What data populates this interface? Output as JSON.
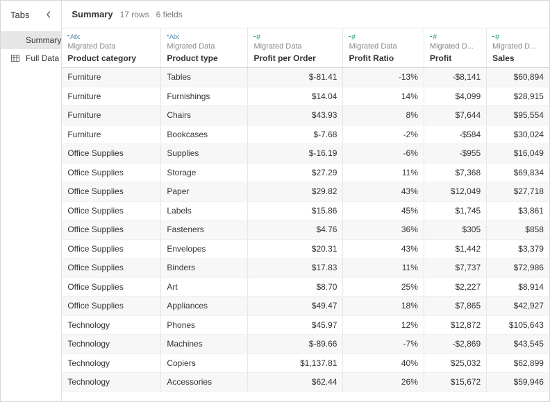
{
  "sidebar": {
    "title": "Tabs",
    "items": [
      {
        "label": "Summary",
        "icon": null,
        "active": true
      },
      {
        "label": "Full Data",
        "icon": "table",
        "active": false
      }
    ]
  },
  "header": {
    "title": "Summary",
    "rows_label": "17 rows",
    "fields_label": "6 fields"
  },
  "columns": [
    {
      "type": "text",
      "type_label": "Abc",
      "source": "Migrated Data",
      "name": "Product category",
      "align": "left"
    },
    {
      "type": "text",
      "type_label": "Abc",
      "source": "Migrated Data",
      "name": "Product type",
      "align": "left"
    },
    {
      "type": "number",
      "type_label": "#",
      "source": "Migrated Data",
      "name": "Profit per Order",
      "align": "right"
    },
    {
      "type": "number",
      "type_label": "#",
      "source": "Migrated Data",
      "name": "Profit Ratio",
      "align": "right"
    },
    {
      "type": "number",
      "type_label": "#",
      "source": "Migrated D...",
      "name": "Profit",
      "align": "right"
    },
    {
      "type": "number",
      "type_label": "#",
      "source": "Migrated D...",
      "name": "Sales",
      "align": "right"
    }
  ],
  "rows": [
    [
      "Furniture",
      "Tables",
      "$-81.41",
      "-13%",
      "-$8,141",
      "$60,894"
    ],
    [
      "Furniture",
      "Furnishings",
      "$14.04",
      "14%",
      "$4,099",
      "$28,915"
    ],
    [
      "Furniture",
      "Chairs",
      "$43.93",
      "8%",
      "$7,644",
      "$95,554"
    ],
    [
      "Furniture",
      "Bookcases",
      "$-7.68",
      "-2%",
      "-$584",
      "$30,024"
    ],
    [
      "Office Supplies",
      "Supplies",
      "$-16.19",
      "-6%",
      "-$955",
      "$16,049"
    ],
    [
      "Office Supplies",
      "Storage",
      "$27.29",
      "11%",
      "$7,368",
      "$69,834"
    ],
    [
      "Office Supplies",
      "Paper",
      "$29.82",
      "43%",
      "$12,049",
      "$27,718"
    ],
    [
      "Office Supplies",
      "Labels",
      "$15.86",
      "45%",
      "$1,745",
      "$3,861"
    ],
    [
      "Office Supplies",
      "Fasteners",
      "$4.76",
      "36%",
      "$305",
      "$858"
    ],
    [
      "Office Supplies",
      "Envelopes",
      "$20.31",
      "43%",
      "$1,442",
      "$3,379"
    ],
    [
      "Office Supplies",
      "Binders",
      "$17.83",
      "11%",
      "$7,737",
      "$72,986"
    ],
    [
      "Office Supplies",
      "Art",
      "$8.70",
      "25%",
      "$2,227",
      "$8,914"
    ],
    [
      "Office Supplies",
      "Appliances",
      "$49.47",
      "18%",
      "$7,865",
      "$42,927"
    ],
    [
      "Technology",
      "Phones",
      "$45.97",
      "12%",
      "$12,872",
      "$105,643"
    ],
    [
      "Technology",
      "Machines",
      "$-89.66",
      "-7%",
      "-$2,869",
      "$43,545"
    ],
    [
      "Technology",
      "Copiers",
      "$1,137.81",
      "40%",
      "$25,032",
      "$62,899"
    ],
    [
      "Technology",
      "Accessories",
      "$62.44",
      "26%",
      "$15,672",
      "$59,946"
    ]
  ]
}
